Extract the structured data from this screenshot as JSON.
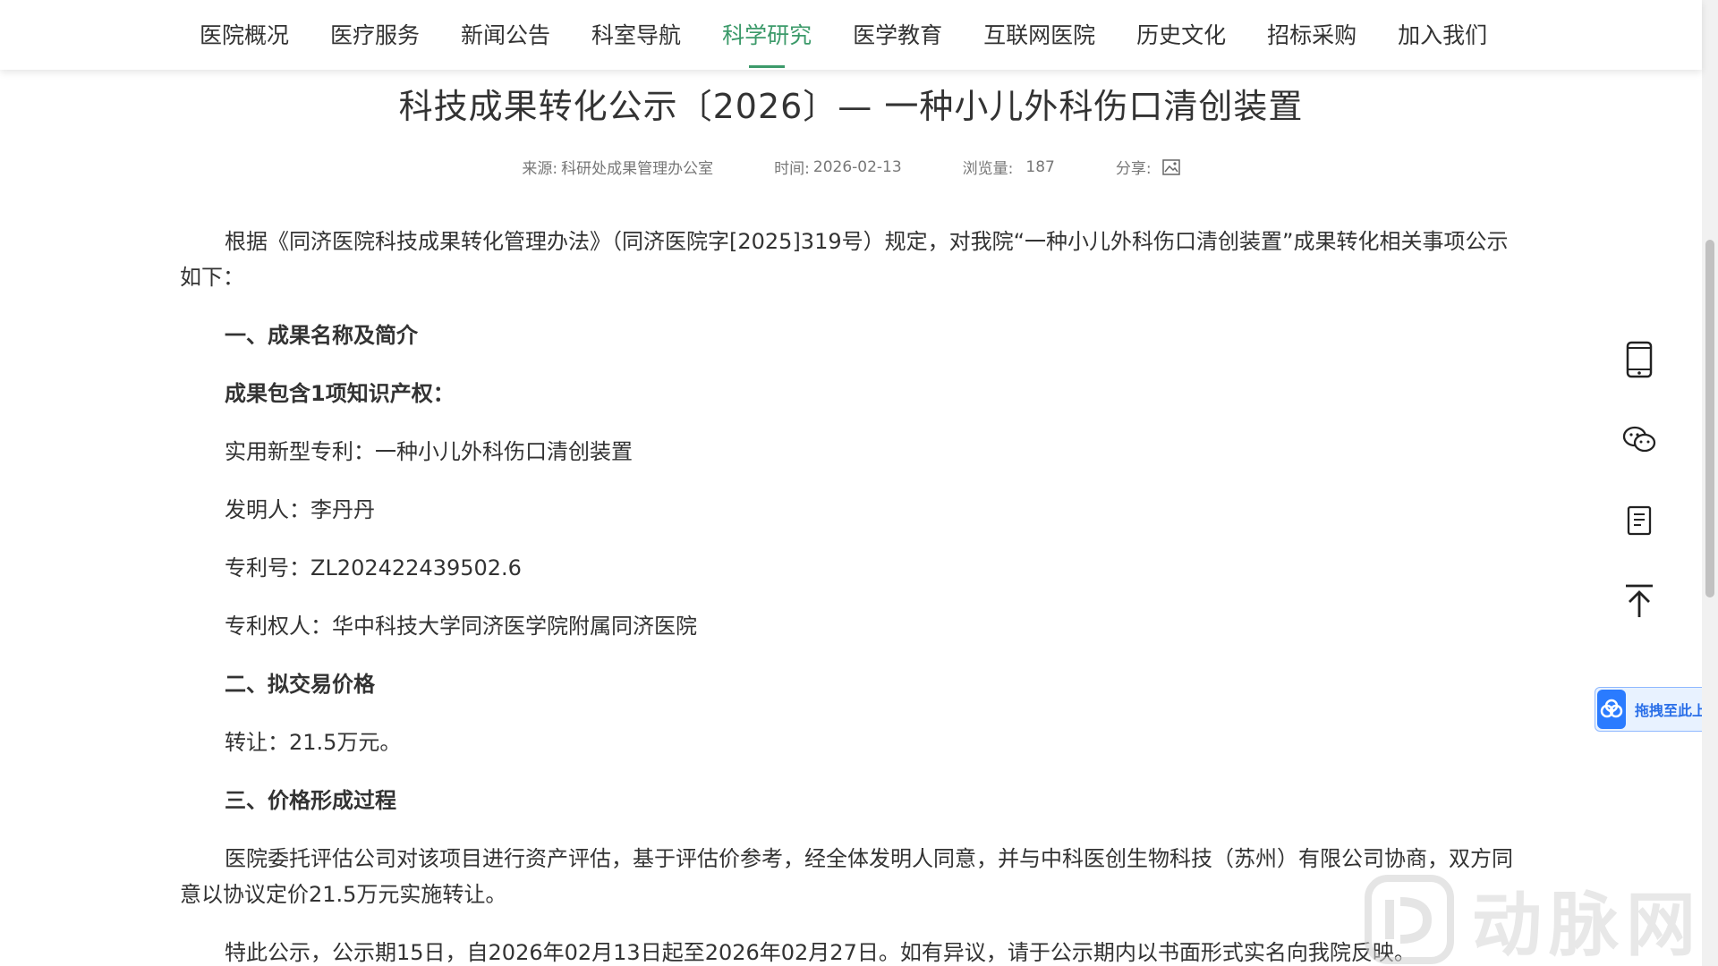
{
  "nav": {
    "items": [
      {
        "label": "医院概况"
      },
      {
        "label": "医疗服务"
      },
      {
        "label": "新闻公告"
      },
      {
        "label": "科室导航"
      },
      {
        "label": "科学研究",
        "active": true
      },
      {
        "label": "医学教育"
      },
      {
        "label": "互联网医院"
      },
      {
        "label": "历史文化"
      },
      {
        "label": "招标采购"
      },
      {
        "label": "加入我们"
      }
    ],
    "active_color": "#3c9a6a"
  },
  "article": {
    "title": "科技成果转化公示〔2026〕— 一种小儿外科伤口清创装置",
    "meta": {
      "source_label": "来源:",
      "source": "科研处成果管理办公室",
      "time_label": "时间:",
      "time": "2026-02-13",
      "views_label": "浏览量:",
      "views": "187",
      "share_label": "分享:"
    },
    "paragraphs": {
      "intro": "根据《同济医院科技成果转化管理办法》（同济医院字[2025]319号）规定，对我院“一种小儿外科伤口清创装置”成果转化相关事项公示如下：",
      "h1": "一、成果名称及简介",
      "ip_heading": "成果包含1项知识产权：",
      "patent_type": "实用新型专利：一种小儿外科伤口清创装置",
      "inventor": "发明人：李丹丹",
      "patent_no": "专利号：ZL202422439502.6",
      "patentee": "专利权人：华中科技大学同济医学院附属同济医院",
      "h2": "二、拟交易价格",
      "price": "转让：21.5万元。",
      "h3": "三、价格形成过程",
      "process": "医院委托评估公司对该项目进行资产评估，基于评估价参考，经全体发明人同意，并与中科医创生物科技（苏州）有限公司协商，双方同意以协议定价21.5万元实施转让。",
      "notice": "特此公示，公示期15日，自2026年02月13日起至2026年02月27日。如有异议，请于公示期内以书面形式实名向我院反映。"
    }
  },
  "side_tools": {
    "icons": [
      "mobile-icon",
      "wechat-icon",
      "bookmark-icon",
      "back-to-top-icon"
    ]
  },
  "upload": {
    "label": "拖拽至此上传",
    "color": "#2a7bff"
  },
  "watermark": {
    "text": "动脉网"
  }
}
